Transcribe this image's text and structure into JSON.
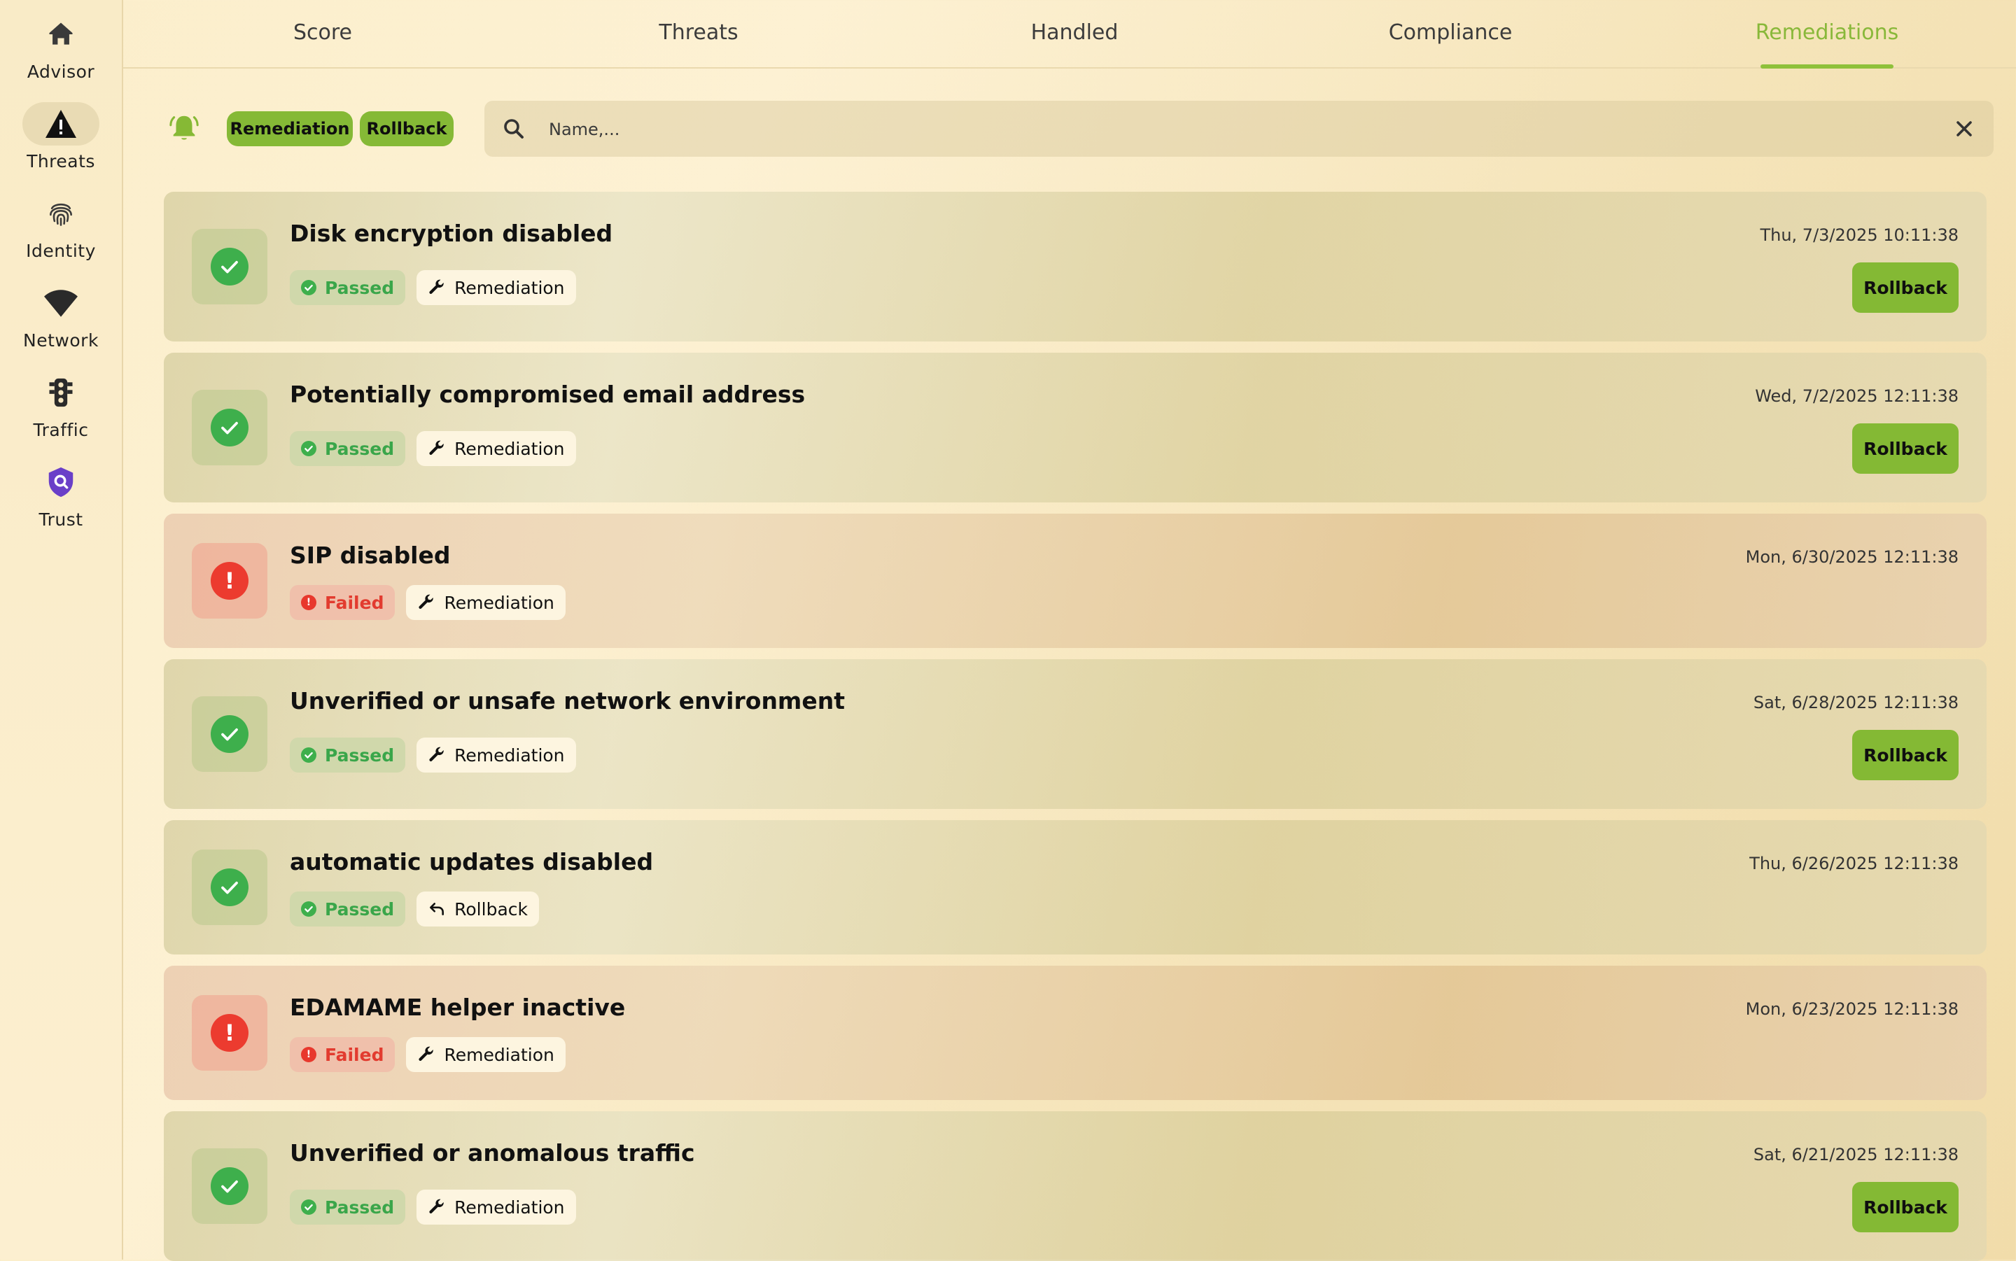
{
  "sidebar": {
    "items": [
      {
        "label": "Advisor",
        "icon": "home-icon",
        "active": false
      },
      {
        "label": "Threats",
        "icon": "warning-icon",
        "active": true
      },
      {
        "label": "Identity",
        "icon": "fingerprint-icon",
        "active": false
      },
      {
        "label": "Network",
        "icon": "wifi-icon",
        "active": false
      },
      {
        "label": "Traffic",
        "icon": "traffic-light-icon",
        "active": false
      },
      {
        "label": "Trust",
        "icon": "shield-search-icon",
        "active": false
      }
    ]
  },
  "tabs": [
    {
      "label": "Score",
      "active": false
    },
    {
      "label": "Threats",
      "active": false
    },
    {
      "label": "Handled",
      "active": false
    },
    {
      "label": "Compliance",
      "active": false
    },
    {
      "label": "Remediations",
      "active": true
    }
  ],
  "filters": {
    "chips": [
      "Remediation",
      "Rollback"
    ],
    "search_placeholder": "Name,...",
    "search_value": ""
  },
  "colors": {
    "accent": "#85b936",
    "passed": "#3eaf4c",
    "failed": "#ec3b2f",
    "active_tab": "#89b83a"
  },
  "items": [
    {
      "title": "Disk encryption disabled",
      "date": "Thu, 7/3/2025 10:11:38",
      "status": "Passed",
      "action": "Remediation",
      "button": "Rollback"
    },
    {
      "title": "Potentially compromised email address",
      "date": "Wed, 7/2/2025 12:11:38",
      "status": "Passed",
      "action": "Remediation",
      "button": "Rollback"
    },
    {
      "title": "SIP disabled",
      "date": "Mon, 6/30/2025 12:11:38",
      "status": "Failed",
      "action": "Remediation",
      "button": ""
    },
    {
      "title": "Unverified or unsafe network environment",
      "date": "Sat, 6/28/2025 12:11:38",
      "status": "Passed",
      "action": "Remediation",
      "button": "Rollback"
    },
    {
      "title": "automatic updates disabled",
      "date": "Thu, 6/26/2025 12:11:38",
      "status": "Passed",
      "action": "Rollback",
      "button": ""
    },
    {
      "title": "EDAMAME helper inactive",
      "date": "Mon, 6/23/2025 12:11:38",
      "status": "Failed",
      "action": "Remediation",
      "button": ""
    },
    {
      "title": "Unverified or anomalous traffic",
      "date": "Sat, 6/21/2025 12:11:38",
      "status": "Passed",
      "action": "Remediation",
      "button": "Rollback"
    }
  ]
}
